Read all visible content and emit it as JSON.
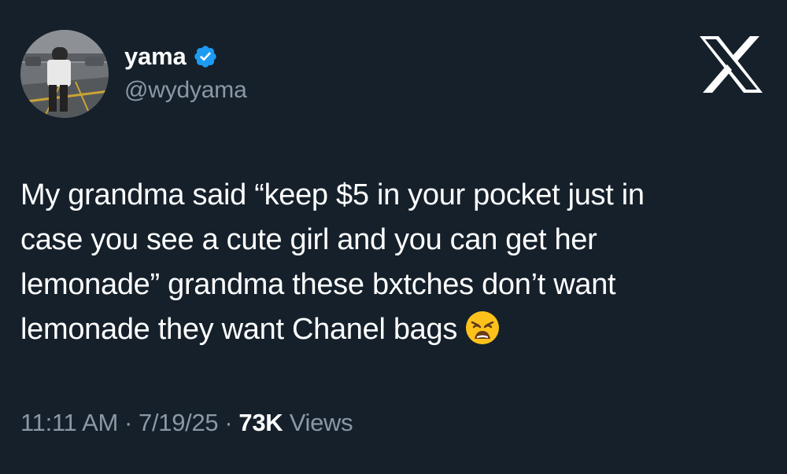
{
  "author": {
    "display_name": "yama",
    "handle": "@wydyama",
    "verified_icon": "verified-badge-icon"
  },
  "brand": {
    "logo_icon": "x-logo-icon"
  },
  "tweet": {
    "lines": [
      "My grandma said “keep $5 in your pocket just in",
      "case you see a cute girl and you can get her",
      "lemonade” grandma these bxtches don’t want",
      "lemonade they want Chanel bags"
    ],
    "emoji": "weary-face-emoji"
  },
  "meta": {
    "time": "11:11 AM",
    "separator": "·",
    "date": "7/19/25",
    "views_count": "73K",
    "views_label": "Views"
  },
  "colors": {
    "background": "#15202b",
    "text_primary": "#ffffff",
    "text_secondary": "#8b98a5",
    "verified_blue": "#1d9bf0"
  }
}
